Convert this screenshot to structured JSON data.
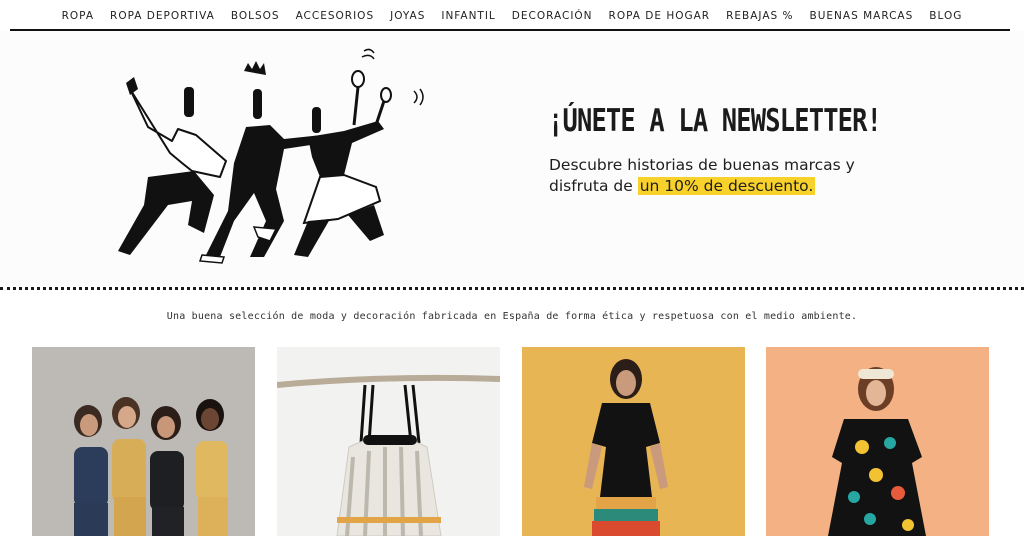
{
  "nav": {
    "items": [
      "ROPA",
      "ROPA DEPORTIVA",
      "BOLSOS",
      "ACCESORIOS",
      "JOYAS",
      "INFANTIL",
      "DECORACIÓN",
      "ROPA DE HOGAR",
      "REBAJAS %",
      "BUENAS MARCAS",
      "BLOG"
    ]
  },
  "hero": {
    "title": "¡ÚNETE A LA NEWSLETTER!",
    "text_line1": "Descubre historias de buenas marcas y",
    "text_line2_prefix": "disfruta de ",
    "text_highlight": "un 10% de descuento.",
    "highlight_color": "#f8d12b"
  },
  "tagline": "Una buena selección de moda y decoración fabricada en España de forma ética y respetuosa con el medio ambiente.",
  "products": [
    {
      "image": "group-of-women-photo",
      "bg": "#bdbab5"
    },
    {
      "image": "backpack-photo",
      "bg": "#f2f2f0"
    },
    {
      "image": "black-dress-photo",
      "bg": "#e7b553"
    },
    {
      "image": "printed-dress-photo",
      "bg": "#f3b184"
    }
  ]
}
